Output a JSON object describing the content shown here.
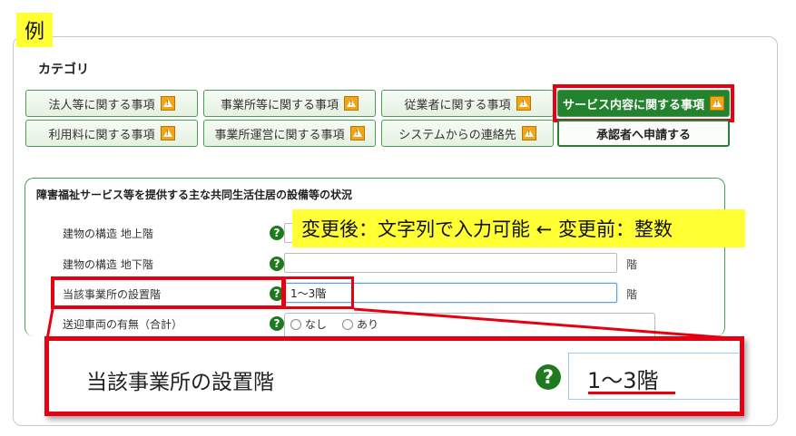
{
  "example_label": "例",
  "category": {
    "title": "カテゴリ",
    "tabs_row1": [
      "法人等に関する事項",
      "事業所等に関する事項",
      "従業者に関する事項",
      "サービス内容に関する事項"
    ],
    "tabs_row2": [
      "利用料に関する事項",
      "事業所運営に関する事項",
      "システムからの連絡先"
    ],
    "approve_button": "承認者へ申請する"
  },
  "section": {
    "title": "障害福祉サービス等を提供する主な共同生活住居の設備等の状況",
    "rows": [
      {
        "label": "建物の構造 地上階",
        "value": "",
        "unit": "階"
      },
      {
        "label": "建物の構造 地下階",
        "value": "",
        "unit": "階"
      },
      {
        "label": "当該事業所の設置階",
        "value": "1～3階",
        "unit": "階"
      },
      {
        "label": "送迎車両の有無（合計）",
        "options": [
          "なし",
          "あり"
        ]
      }
    ]
  },
  "callout": "変更後：文字列で入力可能 ← 変更前：整数",
  "zoom": {
    "label": "当該事業所の設置階",
    "value": "1～3階"
  },
  "colors": {
    "accent_green": "#23822d",
    "highlight_red": "#e60012",
    "callout_yellow": "#ffff33"
  },
  "icons": {
    "warning": "warning-icon",
    "help": "help-icon"
  }
}
